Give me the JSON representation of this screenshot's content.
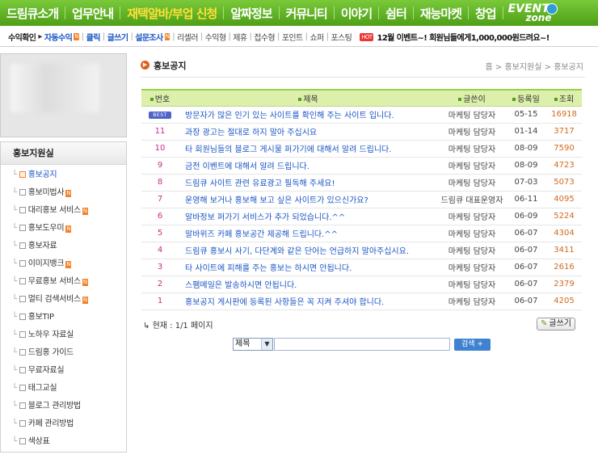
{
  "top_nav": {
    "items": [
      {
        "label": "드림큐소개",
        "highlight": false
      },
      {
        "label": "업무안내",
        "highlight": false
      },
      {
        "label": "재택알바/부업 신청",
        "highlight": true
      },
      {
        "label": "알짜정보",
        "highlight": false
      },
      {
        "label": "커뮤니티",
        "highlight": false
      },
      {
        "label": "이야기",
        "highlight": false
      },
      {
        "label": "쉼터",
        "highlight": false
      },
      {
        "label": "재능마켓",
        "highlight": false
      },
      {
        "label": "창업",
        "highlight": false
      }
    ],
    "event_1": "EVENT",
    "event_2": "zone"
  },
  "sub_nav": {
    "lead": "수익확인",
    "arrow": "▸",
    "items": [
      "자동수익",
      "클릭",
      "글쓰기",
      "설문조사",
      "리셀러",
      "수익형",
      "제휴",
      "접수형",
      "포인트",
      "쇼퍼",
      "포스팅"
    ],
    "new_badge": "N",
    "hot_badge": "HOT",
    "promo_1": "12월 이벤트~! 회원님들에게",
    "promo_2": "1,000,000원",
    "promo_3": "드려요~!"
  },
  "sidebar": {
    "title": "홍보지원실",
    "tree": "└",
    "new_badge": "N",
    "items": [
      {
        "label": "홍보공지",
        "new": false,
        "active": true
      },
      {
        "label": "홍보미법사",
        "new": true,
        "active": false
      },
      {
        "label": "대리홍보 서비스",
        "new": true,
        "active": false
      },
      {
        "label": "홍보도우미",
        "new": true,
        "active": false
      },
      {
        "label": "홍보자료",
        "new": false,
        "active": false
      },
      {
        "label": "이미지뱅크",
        "new": true,
        "active": false
      },
      {
        "label": "무료홍보 서비스",
        "new": true,
        "active": false
      },
      {
        "label": "멀티 검색서비스",
        "new": true,
        "active": false
      },
      {
        "label": "홍보TIP",
        "new": false,
        "active": false
      },
      {
        "label": "노하우 자료실",
        "new": false,
        "active": false
      },
      {
        "label": "드림홍 가이드",
        "new": false,
        "active": false
      },
      {
        "label": "무료자료실",
        "new": false,
        "active": false
      },
      {
        "label": "태그교실",
        "new": false,
        "active": false
      },
      {
        "label": "블로그 관리방법",
        "new": false,
        "active": false
      },
      {
        "label": "카페 관리방법",
        "new": false,
        "active": false
      },
      {
        "label": "색상표",
        "new": false,
        "active": false
      }
    ]
  },
  "page": {
    "title": "홍보공지",
    "title_icon": "▶",
    "breadcrumb": "홈 > 홍보지원실 > 홍보공지"
  },
  "board": {
    "columns": {
      "no": "번호",
      "subject": "제목",
      "writer": "글쓴이",
      "date": "등록일",
      "views": "조회"
    },
    "best_label": "BEST",
    "rows": [
      {
        "no": "",
        "best": true,
        "subject": "방문자가 많은 인기 있는 사이트를 확인해 주는 사이트 입니다.",
        "writer": "마케팅 담당자",
        "date": "05-15",
        "views": "16918"
      },
      {
        "no": "11",
        "best": false,
        "subject": "과장 광고는 절대로 하지 말아 주십시요",
        "writer": "마케팅 담당자",
        "date": "01-14",
        "views": "3717"
      },
      {
        "no": "10",
        "best": false,
        "subject": "타 회원님들의 블로그 게시물 퍼가기에 대해서 알려 드립니다.",
        "writer": "마케팅 담당자",
        "date": "08-09",
        "views": "7590"
      },
      {
        "no": "9",
        "best": false,
        "subject": "금전 이벤트에 대해서 알려 드립니다.",
        "writer": "마케팅 담당자",
        "date": "08-09",
        "views": "4723"
      },
      {
        "no": "8",
        "best": false,
        "subject": "드림큐 사이트 관련 유료광고 필독해 주세요!",
        "writer": "마케팅 담당자",
        "date": "07-03",
        "views": "5073"
      },
      {
        "no": "7",
        "best": false,
        "subject": "운영해 보거나 홍보해 보고 싶은 사이트가 있으신가요?",
        "writer": "드림큐 대표운영자",
        "date": "06-11",
        "views": "4095"
      },
      {
        "no": "6",
        "best": false,
        "subject": "알바정보 퍼가기 서비스가 추가 되었습니다.^^",
        "writer": "마케팅 담당자",
        "date": "06-09",
        "views": "5224"
      },
      {
        "no": "5",
        "best": false,
        "subject": "알바위즈 카페 홍보공간 제공해 드립니다.^^",
        "writer": "마케팅 담당자",
        "date": "06-07",
        "views": "4304"
      },
      {
        "no": "4",
        "best": false,
        "subject": "드림큐 홍보시 사기, 다단계와 같은 단어는 언급하지 말아주십시요.",
        "writer": "마케팅 담당자",
        "date": "06-07",
        "views": "3411"
      },
      {
        "no": "3",
        "best": false,
        "subject": "타 사이트에 피해를 주는 홍보는 하시면 안됩니다.",
        "writer": "마케팅 담당자",
        "date": "06-07",
        "views": "2616"
      },
      {
        "no": "2",
        "best": false,
        "subject": "스팸메일은 발송하시면 안됩니다.",
        "writer": "마케팅 담당자",
        "date": "06-07",
        "views": "2379"
      },
      {
        "no": "1",
        "best": false,
        "subject": "홍보공지 게시판에 등록된 사항들은 꼭 지켜 주셔야 합니다.",
        "writer": "마케팅 담당자",
        "date": "06-07",
        "views": "4205"
      }
    ],
    "page_info": "현재 : 1/1 페이지",
    "write_label": "글쓰기"
  },
  "search": {
    "select_value": "제목",
    "input_value": "",
    "button_label": "검색 +"
  }
}
